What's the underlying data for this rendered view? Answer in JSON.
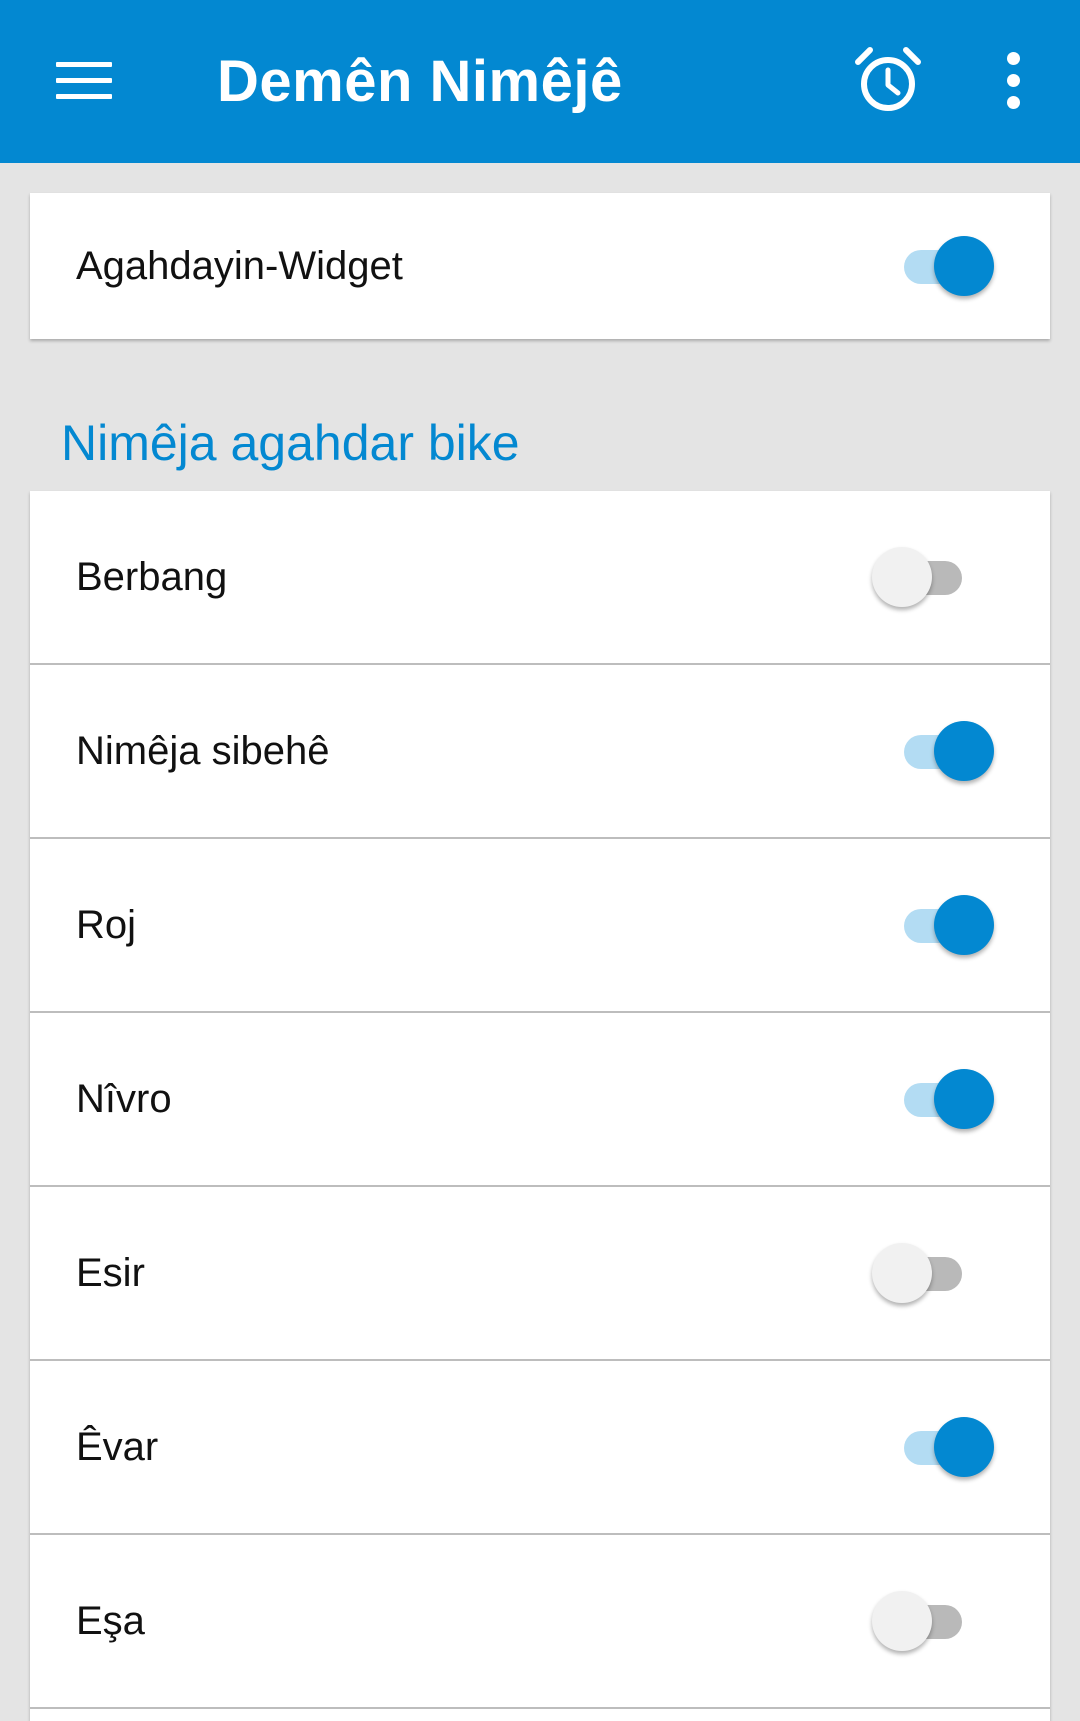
{
  "appbar": {
    "title": "Demên Nimêjê",
    "menu_icon": "hamburger-menu-icon",
    "alarm_icon": "alarm-clock-icon",
    "more_icon": "more-vertical-icon"
  },
  "widget_card": {
    "label": "Agahdayin-Widget",
    "enabled": true
  },
  "section": {
    "title": "Nimêja agahdar bike"
  },
  "prayers": [
    {
      "label": "Berbang",
      "enabled": false
    },
    {
      "label": "Nimêja sibehê",
      "enabled": true
    },
    {
      "label": "Roj",
      "enabled": true
    },
    {
      "label": "Nîvro",
      "enabled": true
    },
    {
      "label": "Esir",
      "enabled": false
    },
    {
      "label": "Êvar",
      "enabled": true
    },
    {
      "label": "Eşa",
      "enabled": false
    }
  ],
  "colors": {
    "primary": "#0388d1",
    "toggle_on_track": "#b3dcf3",
    "toggle_off_track": "#b9b9b9",
    "background": "#e4e4e4"
  }
}
